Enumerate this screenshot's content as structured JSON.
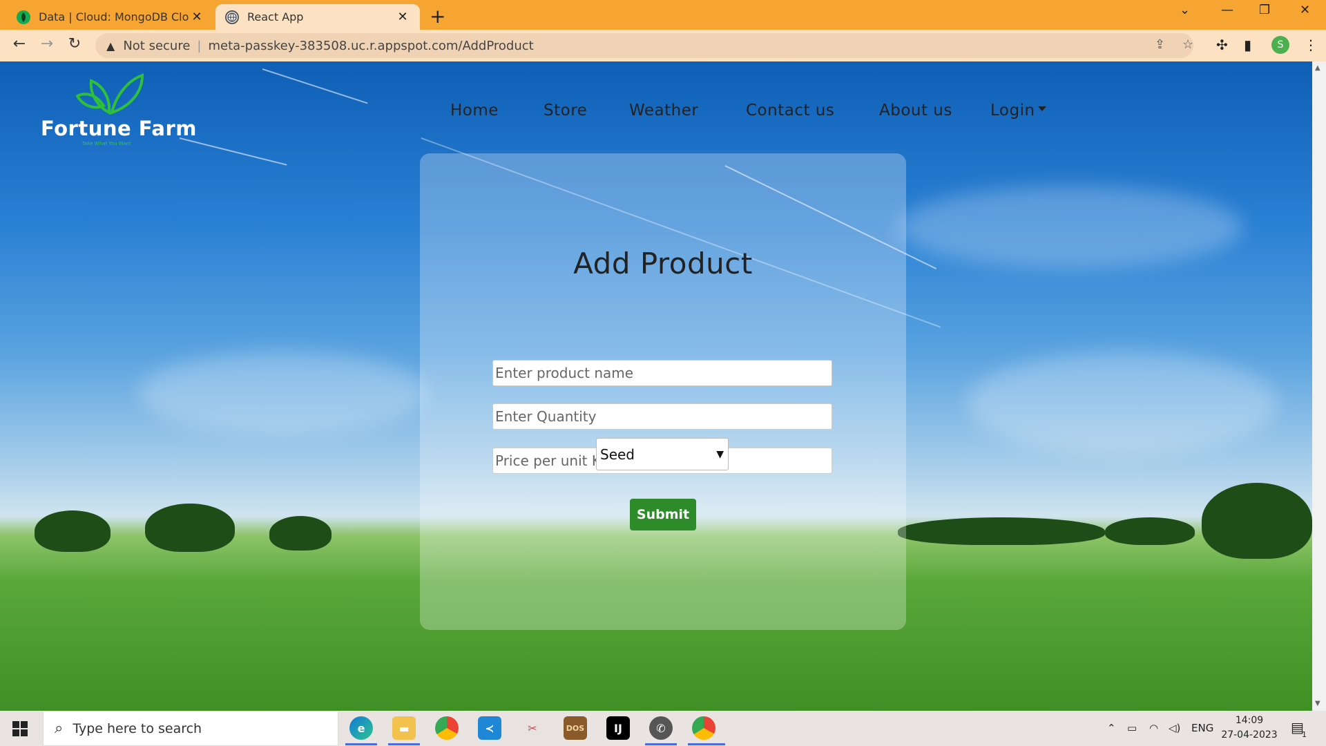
{
  "browser": {
    "tabs": [
      {
        "title": "Data | Cloud: MongoDB Cloud",
        "active": false,
        "icon": "mongodb-leaf-icon"
      },
      {
        "title": "React App",
        "active": true,
        "icon": "globe-icon"
      }
    ],
    "address": {
      "security": "Not secure",
      "url": "meta-passkey-383508.uc.r.appspot.com/AddProduct"
    },
    "profile_initial": "S",
    "accent": "#f7a532"
  },
  "site": {
    "logo": {
      "name": "Fortune Farm",
      "tagline": "Take What You Want"
    },
    "nav": [
      "Home",
      "Store",
      "Weather",
      "Contact us",
      "About us"
    ],
    "login": "Login"
  },
  "form": {
    "title": "Add Product",
    "product_name_placeholder": "Enter product name",
    "quantity_placeholder": "Enter Quantity",
    "price_placeholder": "Price per unit Kg",
    "category_selected": "Seed",
    "submit_label": "Submit",
    "submit_color": "#2e8b2a"
  },
  "taskbar": {
    "search_placeholder": "Type here to search",
    "language": "ENG",
    "time": "14:09",
    "date": "27-04-2023",
    "notifications": "1"
  }
}
